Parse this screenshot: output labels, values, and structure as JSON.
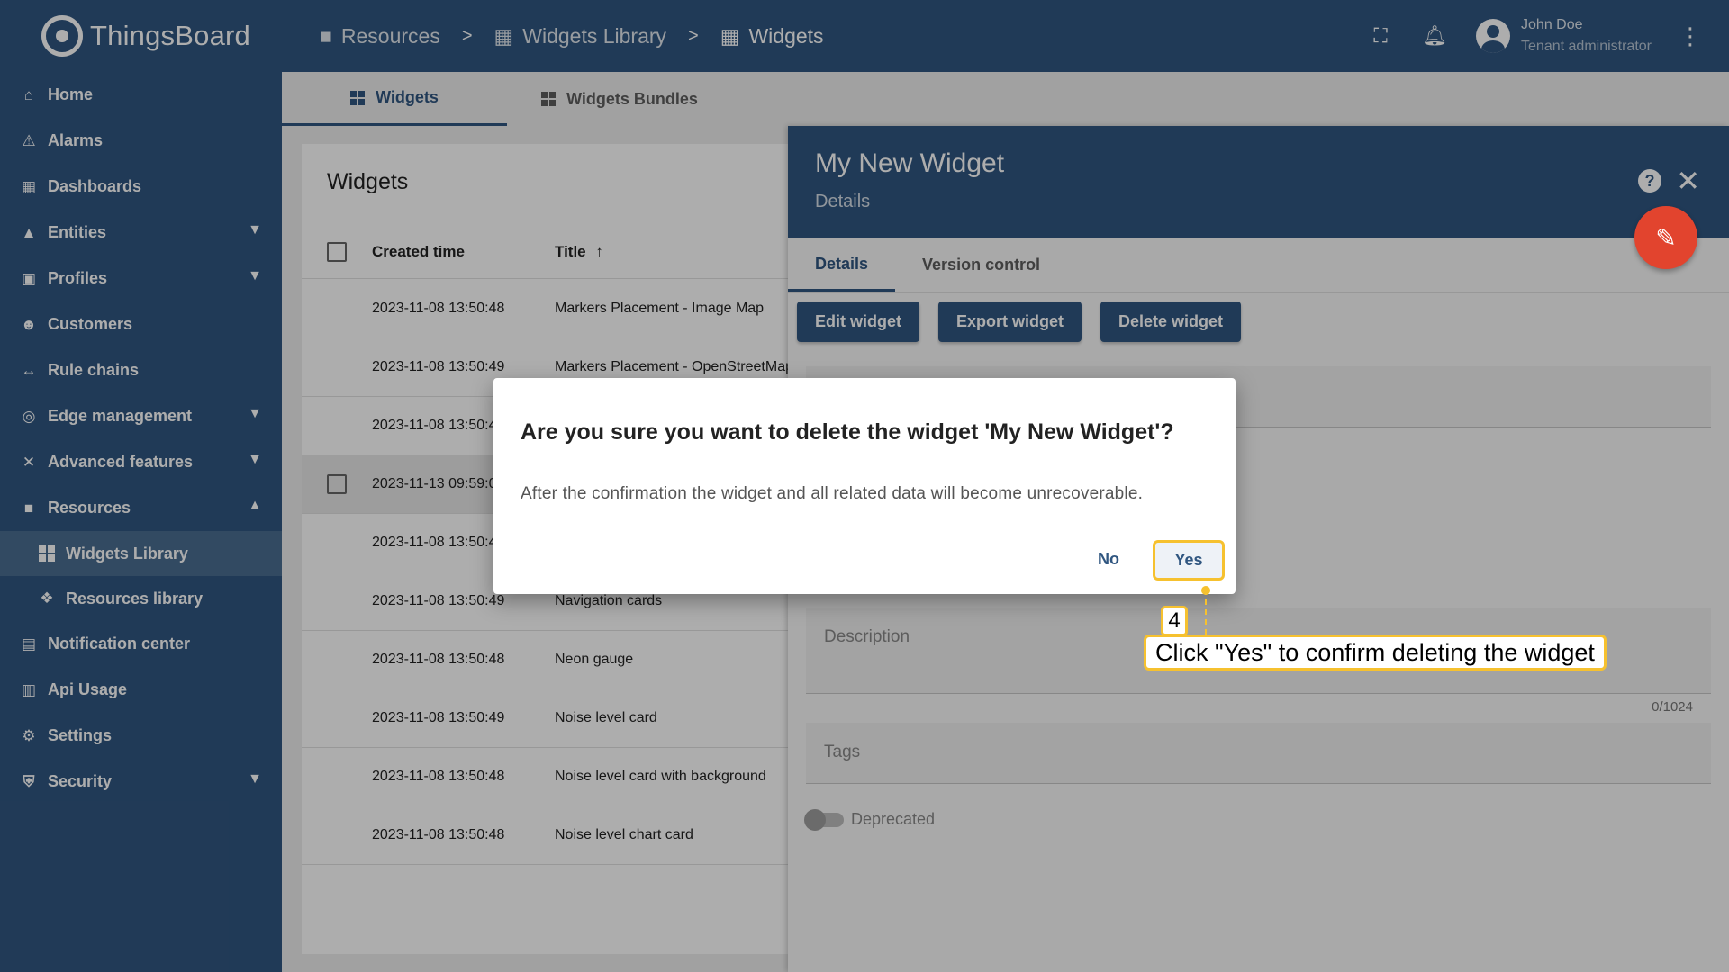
{
  "app": {
    "logo_text": "ThingsBoard"
  },
  "sidebar": {
    "items": [
      {
        "label": "Home",
        "icon": "home-icon"
      },
      {
        "label": "Alarms",
        "icon": "alarm-icon"
      },
      {
        "label": "Dashboards",
        "icon": "dashboard-icon"
      },
      {
        "label": "Entities",
        "icon": "entities-icon"
      },
      {
        "label": "Profiles",
        "icon": "profiles-icon"
      },
      {
        "label": "Customers",
        "icon": "customers-icon"
      },
      {
        "label": "Rule chains",
        "icon": "rule-chains-icon"
      },
      {
        "label": "Edge management",
        "icon": "edge-icon"
      },
      {
        "label": "Advanced features",
        "icon": "tools-icon"
      },
      {
        "label": "Resources",
        "icon": "folder-icon"
      },
      {
        "label": "Widgets Library",
        "icon": "widgets-icon"
      },
      {
        "label": "Resources library",
        "icon": "resources-library-icon"
      },
      {
        "label": "Notification center",
        "icon": "notification-icon"
      },
      {
        "label": "Api Usage",
        "icon": "api-usage-icon"
      },
      {
        "label": "Settings",
        "icon": "gear-icon"
      },
      {
        "label": "Security",
        "icon": "shield-icon"
      }
    ]
  },
  "breadcrumb": {
    "items": [
      "Resources",
      "Widgets Library",
      "Widgets"
    ],
    "separator": ">"
  },
  "user": {
    "name": "John Doe",
    "role": "Tenant administrator"
  },
  "tabs": {
    "widgets": "Widgets",
    "bundles": "Widgets Bundles"
  },
  "table": {
    "title": "Widgets",
    "columns": {
      "created": "Created time",
      "title": "Title",
      "sort_arrow": "↑"
    },
    "rows": [
      {
        "time": "2023-11-08 13:50:48",
        "title": "Markers Placement - Image Map"
      },
      {
        "time": "2023-11-08 13:50:49",
        "title": "Markers Placement - OpenStreetMap"
      },
      {
        "time": "2023-11-08 13:50:4",
        "title": ""
      },
      {
        "time": "2023-11-13 09:59:0",
        "title": ""
      },
      {
        "time": "2023-11-08 13:50:4",
        "title": ""
      },
      {
        "time": "2023-11-08 13:50:49",
        "title": "Navigation cards"
      },
      {
        "time": "2023-11-08 13:50:48",
        "title": "Neon gauge"
      },
      {
        "time": "2023-11-08 13:50:49",
        "title": "Noise level card"
      },
      {
        "time": "2023-11-08 13:50:48",
        "title": "Noise level card with background"
      },
      {
        "time": "2023-11-08 13:50:48",
        "title": "Noise level chart card"
      }
    ]
  },
  "panel": {
    "title": "My New Widget",
    "subtitle": "Details",
    "help": "?",
    "close": "✕",
    "tabs": [
      "Details",
      "Version control"
    ],
    "buttons": [
      "Edit widget",
      "Export widget",
      "Delete widget"
    ],
    "fields": {
      "description": "Description",
      "tags": "Tags"
    },
    "counter": "0/1024",
    "deprecated": "Deprecated"
  },
  "dialog": {
    "title": "Are you sure you want to delete the widget 'My New Widget'?",
    "text": "After the confirmation the widget and all related data will become unrecoverable.",
    "no": "No",
    "yes": "Yes"
  },
  "annotation": {
    "step": "4",
    "text": "Click \"Yes\" to confirm deleting the widget",
    "color": "#f6c12f"
  },
  "colors": {
    "primary": "#305680",
    "fab": "#e2442e"
  }
}
